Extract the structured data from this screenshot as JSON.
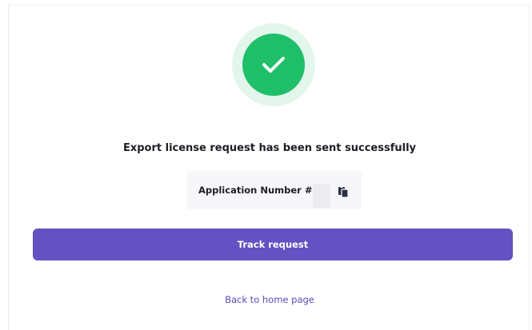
{
  "success": {
    "icon": "checkmark-icon",
    "message": "Export license request has been sent successfully"
  },
  "application": {
    "label": "Application Number #",
    "value": "",
    "copy_icon": "copy-icon"
  },
  "actions": {
    "track_label": "Track request",
    "back_label": "Back to home page"
  },
  "colors": {
    "success_green": "#1fbf6a",
    "success_ring": "#e3f6ec",
    "primary_purple": "#6451c2",
    "link_purple": "#5b4bb8"
  }
}
